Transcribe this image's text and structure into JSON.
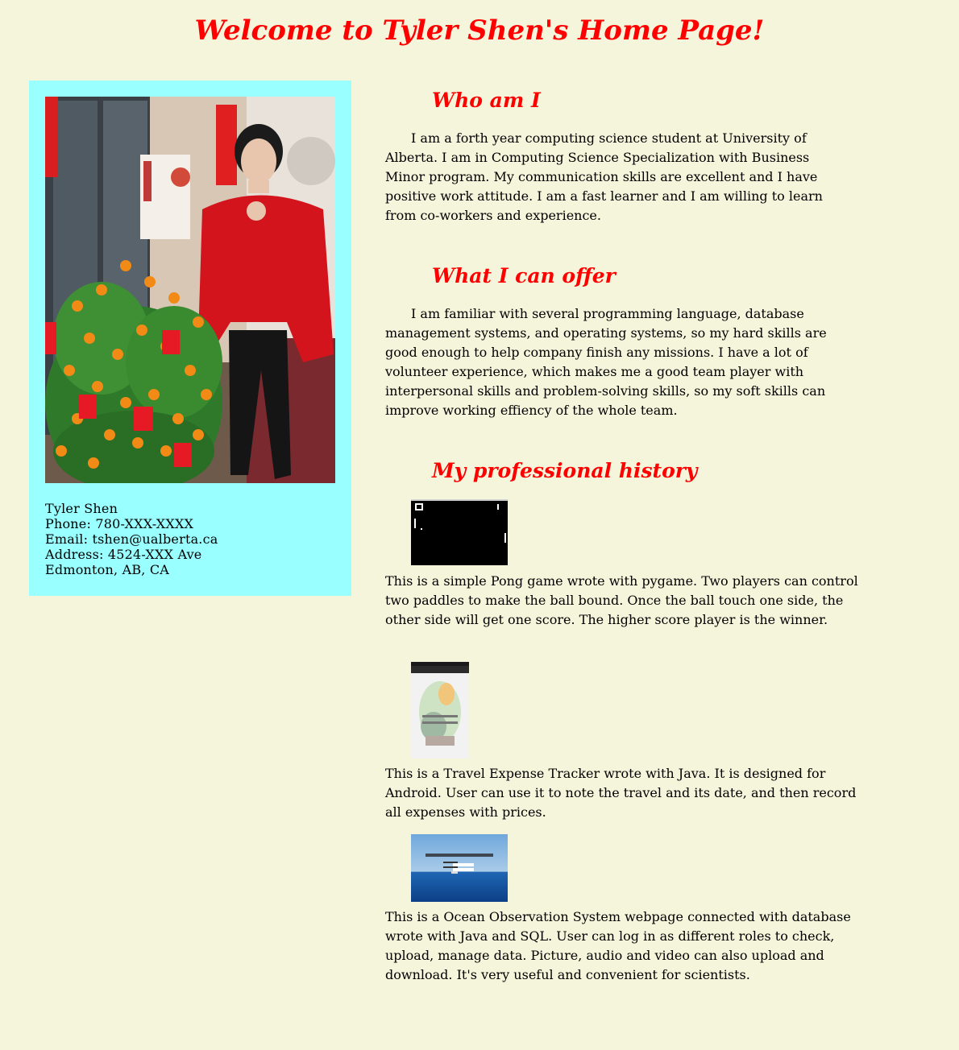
{
  "page": {
    "title": "Welcome to Tyler Shen's Home Page!"
  },
  "profile": {
    "photo_icon": "portrait-photo",
    "contact": [
      "Tyler Shen",
      "Phone: 780-XXX-XXXX",
      "Email: tshen@ualberta.ca",
      "Address: 4524-XXX Ave",
      "Edmonton, AB, CA"
    ]
  },
  "sections": {
    "who": {
      "heading": "Who am I",
      "text": "I am a forth year computing science student at University of Alberta. I am in Computing Science Specialization with Business Minor program. My communication skills are excellent and I have positive work attitude. I am a fast learner and I am willing to learn from co-workers and experience."
    },
    "offer": {
      "heading": "What I can offer",
      "text": "I am familiar with several programming language, database management systems, and operating systems, so my hard skills are good enough to help company finish any missions. I have a lot of volunteer experience, which makes me a good team player with interpersonal skills and problem-solving skills, so my soft skills can improve working effiency of the whole team."
    },
    "history": {
      "heading": "My professional history",
      "projects": [
        {
          "image": "pong-game-screenshot",
          "description": "This is a simple Pong game wrote with pygame. Two players can control two paddles to make the ball bound. Once the ball touch one side, the other side will get one score. The higher score player is the winner."
        },
        {
          "image": "travel-expense-app-screenshot",
          "description": "This is a Travel Expense Tracker wrote with Java. It is designed for Android. User can use it to note the travel and its date, and then record all expenses with prices."
        },
        {
          "image": "ocean-observation-webpage-screenshot",
          "description": "This is a Ocean Observation System webpage connected with database wrote with Java and SQL. User can log in as different roles to check, upload, manage data. Picture, audio and video can also upload and download. It's very useful and convenient for scientists."
        }
      ]
    }
  },
  "colors": {
    "background": "#f5f5dc",
    "heading": "#ff0000",
    "card": "#99ffff"
  }
}
